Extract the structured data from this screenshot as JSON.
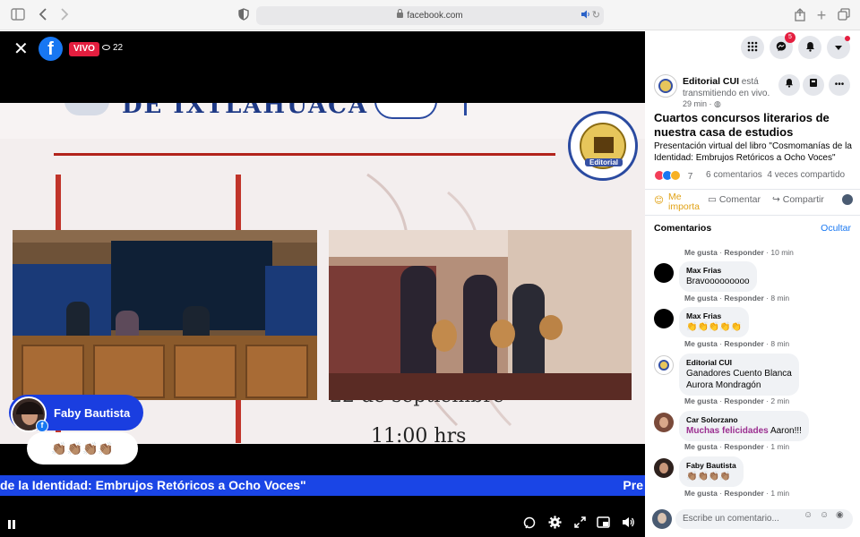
{
  "browser": {
    "url": "facebook.com"
  },
  "video": {
    "live_label": "VIVO",
    "viewer_count": "22",
    "slide": {
      "title": "DE IXTLAHUACA CUI",
      "editorial_label": "Editorial",
      "datetime_date": "22 de septiembre",
      "datetime_time": "11:00 hrs",
      "banner_text": "de la Identidad: Embrujos Retóricos a Ocho Voces\"",
      "banner_next": "Pre"
    },
    "overlay_commenter": {
      "name": "Faby Bautista",
      "emojis": "👏🏽👏🏽👏🏽👏🏽"
    }
  },
  "post": {
    "author": "Editorial CUI",
    "author_suffix": "está transmitiendo en vivo.",
    "time": "29 min",
    "title": "Cuartos concursos literarios de nuestra casa de estudios",
    "description": "Presentación virtual del libro \"Cosmomanías de la Identidad: Embrujos Retóricos a Ocho Voces\"",
    "reaction_count": "7",
    "comment_count": "6 comentarios",
    "share_count": "4 veces compartido",
    "actions": {
      "like": "Me importa",
      "comment": "Comentar",
      "share": "Compartir"
    }
  },
  "comments": {
    "header": "Comentarios",
    "hide_label": "Ocultar",
    "like_label": "Me gusta",
    "reply_label": "Responder",
    "first_meta_time": "10 min",
    "items": [
      {
        "name": "Max Frias",
        "text": "Bravooooooooo",
        "time": "8 min"
      },
      {
        "name": "Max Frias",
        "text": "👏👏👏👏👏",
        "time": "8 min"
      },
      {
        "name": "Editorial CUI",
        "text_line1": "Ganadores Cuento Blanca",
        "text_line2": "Aurora Mondragón",
        "time": "2 min"
      },
      {
        "name": "Car Solorzano",
        "tag": "Muchas felicidades",
        "text": "Aaron!!!",
        "time": "1 min"
      },
      {
        "name": "Faby Bautista",
        "text": "👏🏽👏🏽👏🏽👏🏽",
        "time": "1 min"
      }
    ],
    "input_placeholder": "Escribe un comentario..."
  },
  "notifications": {
    "messenger_badge": "5"
  }
}
